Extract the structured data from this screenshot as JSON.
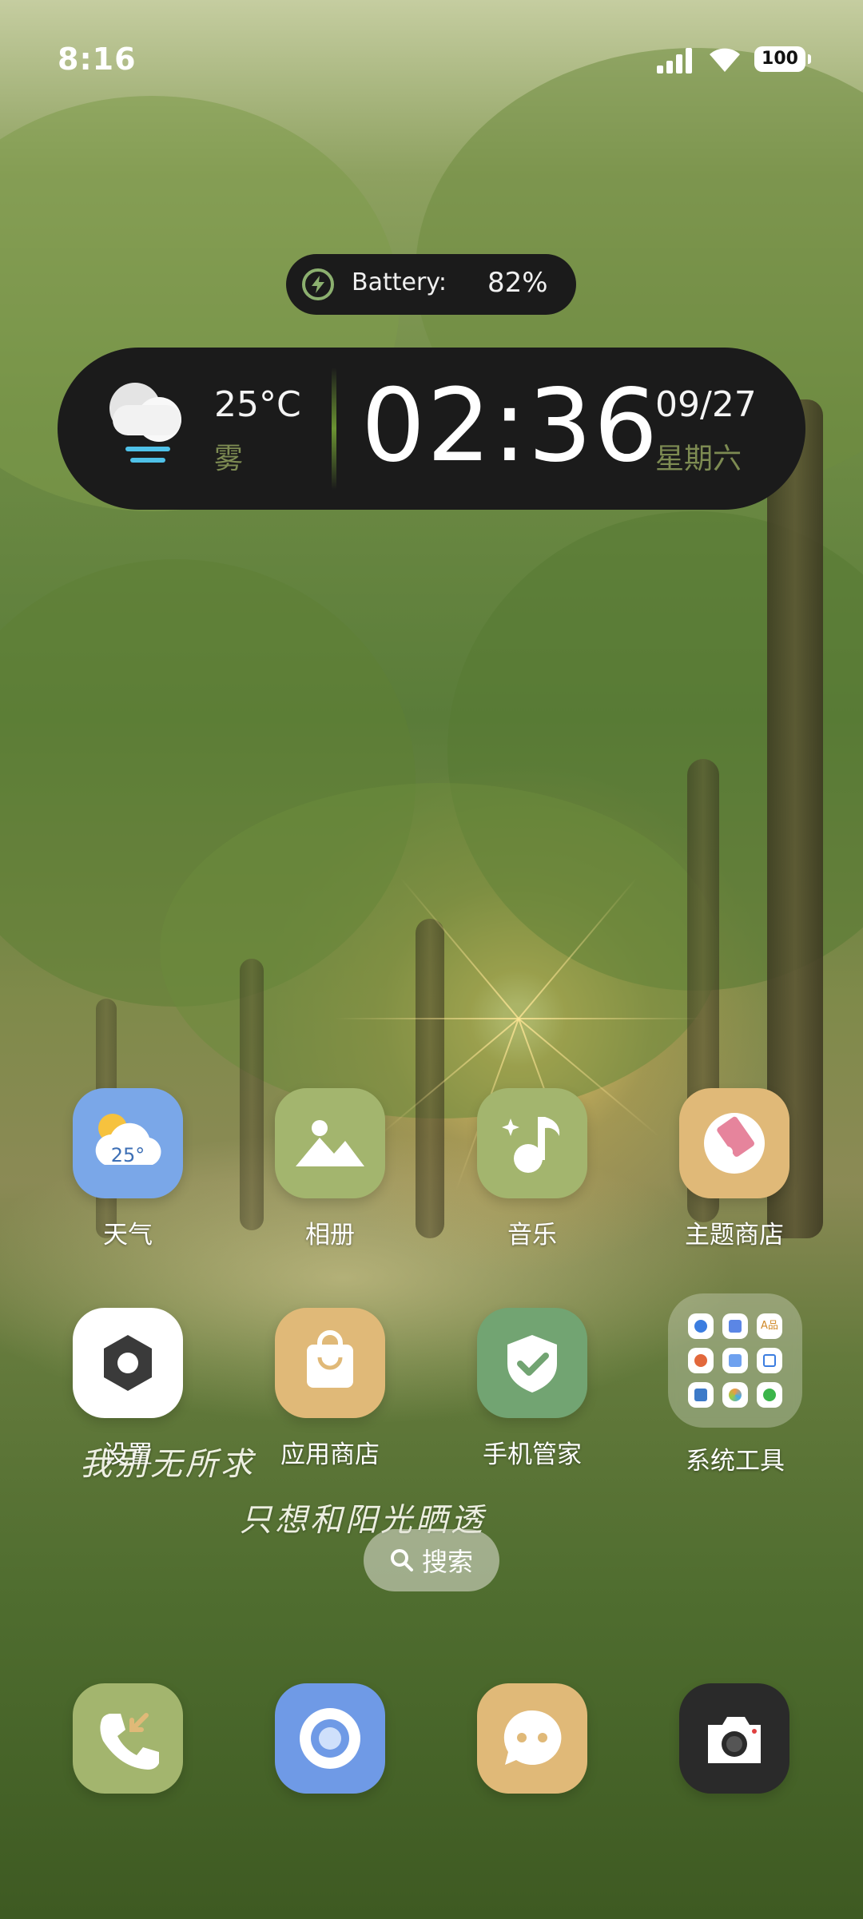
{
  "status_bar": {
    "time": "8:16",
    "battery_level": "100"
  },
  "battery_widget": {
    "label": "Battery:",
    "value": "82%"
  },
  "widget": {
    "temperature": "25°C",
    "condition": "雾",
    "time": "02:36",
    "date": "09/27",
    "weekday": "星期六"
  },
  "apps_row1": [
    {
      "label": "天气",
      "badge": "25°",
      "color": "#7aa7e8",
      "icon": "weather-icon"
    },
    {
      "label": "相册",
      "color": "#a3b56e",
      "icon": "gallery-icon"
    },
    {
      "label": "音乐",
      "color": "#a3b56e",
      "icon": "music-icon"
    },
    {
      "label": "主题商店",
      "color": "#e0b978",
      "icon": "theme-store-icon"
    }
  ],
  "apps_row2": [
    {
      "label": "设置",
      "color": "#ffffff",
      "icon": "settings-icon"
    },
    {
      "label": "应用商店",
      "color": "#e0b978",
      "icon": "app-store-icon"
    },
    {
      "label": "手机管家",
      "color": "#72a472",
      "icon": "phone-manager-icon"
    }
  ],
  "folder": {
    "label": "系统工具",
    "mini_label": "A品"
  },
  "wallpaper_text": {
    "line1": "我别无所求",
    "line2": "只想和阳光晒透"
  },
  "search": {
    "label": "搜索"
  },
  "dock": [
    {
      "name": "phone",
      "color": "#a3b56e",
      "icon": "phone-icon"
    },
    {
      "name": "browser",
      "color": "#6f9ae6",
      "icon": "browser-icon"
    },
    {
      "name": "messages",
      "color": "#e0b978",
      "icon": "messages-icon"
    },
    {
      "name": "camera",
      "color": "#2a2a2a",
      "icon": "camera-icon"
    }
  ]
}
